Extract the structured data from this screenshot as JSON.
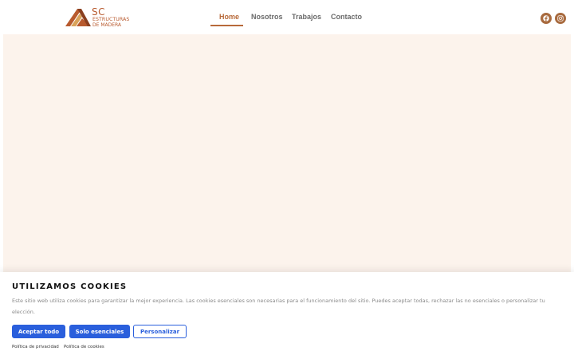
{
  "header": {
    "logo": {
      "brand": "SC",
      "line1": "ESTRUCTURAS",
      "line2": "DE MADERA"
    },
    "nav": [
      {
        "label": "Home",
        "active": true
      },
      {
        "label": "Nosotros",
        "active": false
      },
      {
        "label": "Trabajos",
        "active": false
      },
      {
        "label": "Contacto",
        "active": false
      }
    ],
    "social": [
      {
        "icon": "facebook-icon"
      },
      {
        "icon": "instagram-icon"
      }
    ]
  },
  "colors": {
    "accent": "#b86a3a",
    "hero_bg": "#fcf3ec",
    "button_blue": "#2a5fdc"
  },
  "cookie_banner": {
    "title": "UTILIZAMOS COOKIES",
    "text": "Este sitio web utiliza cookies para garantizar la mejor experiencia. Las cookies esenciales son necesarias para el funcionamiento del sitio. Puedes aceptar todas, rechazar las no esenciales o personalizar tu elección.",
    "buttons": {
      "accept_all": "Aceptar todo",
      "essentials_only": "Solo esenciales",
      "customize": "Personalizar"
    },
    "links": {
      "privacy": "Política de privacidad",
      "cookies": "Política de cookies"
    }
  }
}
